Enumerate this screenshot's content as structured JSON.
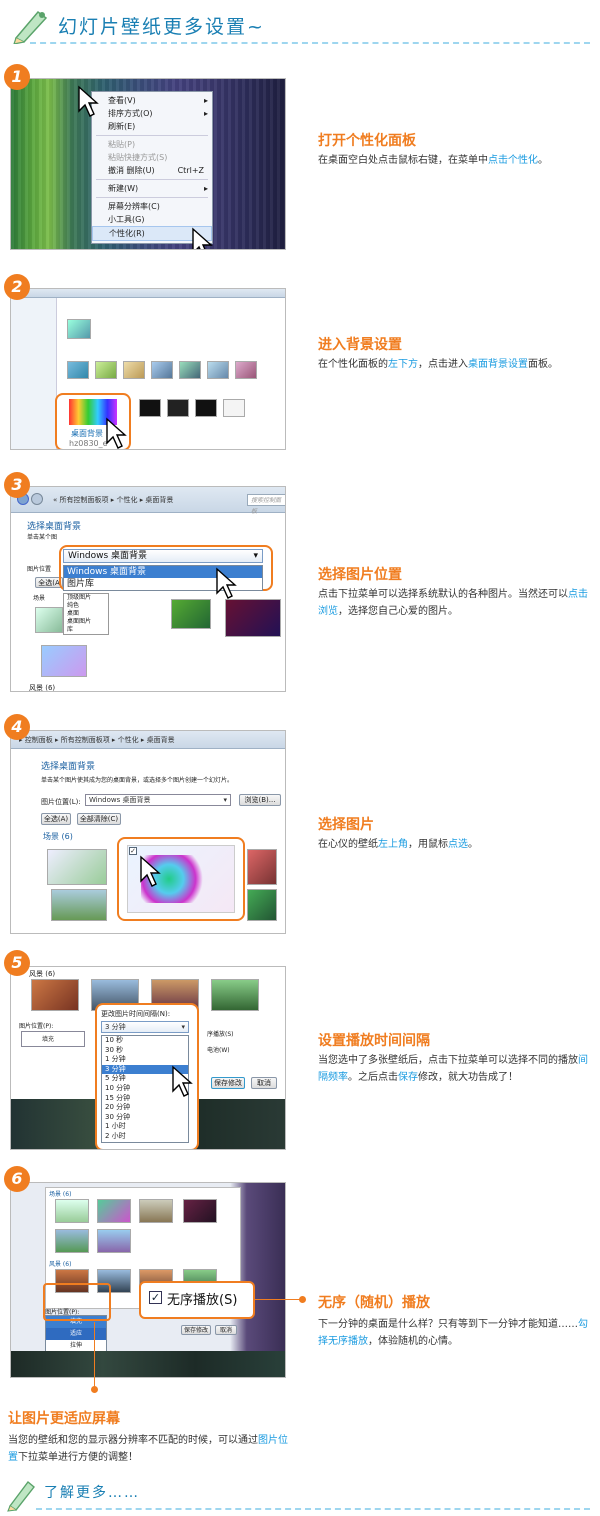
{
  "header": {
    "title": "幻灯片壁纸更多设置~"
  },
  "footer": {
    "title": "了解更多……"
  },
  "steps": [
    {
      "num": "1",
      "title": "打开个性化面板",
      "desc_a": "在桌面空白处点击鼠标右键，在菜单中",
      "desc_hl": "点击个性化",
      "desc_b": "。"
    },
    {
      "num": "2",
      "title": "进入背景设置",
      "desc_a": "在个性化面板的",
      "desc_hl1": "左下方",
      "desc_b": "，点击进入",
      "desc_hl2": "桌面背景设置",
      "desc_c": "面板。"
    },
    {
      "num": "3",
      "title": "选择图片位置",
      "desc_a": "点击下拉菜单可以选择系统默认的各种图片。当然还可以",
      "desc_hl": "点击浏览",
      "desc_b": "，选择您自己心爱的图片。"
    },
    {
      "num": "4",
      "title": "选择图片",
      "desc_a": "在心仪的壁纸",
      "desc_hl1": "左上角",
      "desc_b": "，用鼠标",
      "desc_hl2": "点选",
      "desc_c": "。"
    },
    {
      "num": "5",
      "title": "设置播放时间间隔",
      "desc_a": "当您选中了多张壁纸后，点击下拉菜单可以选择不同的播放",
      "desc_hl1": "间隔频率",
      "desc_b": "。之后点击",
      "desc_hl2": "保存",
      "desc_c": "修改，就大功告成了！"
    },
    {
      "num": "6",
      "title": "无序（随机）播放",
      "desc_a": "下一分钟的桌面是什么样？只有等到下一分钟才能知道……",
      "desc_hl": "勾择无序播放",
      "desc_b": "，体验随机的心情。"
    }
  ],
  "extra": {
    "title": "让图片更适应屏幕",
    "desc_a": "当您的壁纸和您的显示器分辨率不匹配的时候，可以通过",
    "desc_hl": "图片位置",
    "desc_b": "下拉菜单进行方便的调整！"
  },
  "shot1": {
    "menu": [
      "查看(V)",
      "排序方式(O)",
      "刷新(E)",
      "粘贴(P)",
      "粘贴快捷方式(S)",
      "撤消 删除(U)",
      "新建(W)",
      "屏幕分辨率(C)",
      "小工具(G)",
      "个性化(R)"
    ],
    "shortcut": "Ctrl+Z"
  },
  "shot2": {
    "big_label": "桌面背景",
    "file": "hz0830_e"
  },
  "shot3": {
    "bar": "« 所有控制面板项 ▸ 个性化 ▸ 桌面背景",
    "search": "搜索控制面板",
    "heading": "选择桌面背景",
    "sub": "单击某个图",
    "pos": "图片位置",
    "all": "全选(A",
    "dropdown": "Windows 桌面背景",
    "options": [
      "Windows 桌面背景",
      "图片库"
    ],
    "tree": [
      "顶级图片",
      "纯色",
      "桌面",
      "桌面图片",
      "库"
    ],
    "group": "风景 (6)",
    "group_top": "场景"
  },
  "shot4": {
    "bar": "▸ 控制面板 ▸ 所有控制面板项 ▸ 个性化 ▸ 桌面背景",
    "heading": "选择桌面背景",
    "sub": "单击某个图片使其成为您的桌面背景，或选择多个图片创建一个幻灯片。",
    "pos": "图片位置(L):",
    "dropdown": "Windows 桌面背景",
    "browse": "浏览(B)...",
    "all": "全选(A)",
    "clear": "全部清除(C)",
    "group": "场景 (6)"
  },
  "shot5": {
    "group": "风景 (6)",
    "pos": "图片位置(P):",
    "fill": "填充",
    "interval_label": "更改图片时间间隔(N):",
    "selected": "3 分钟",
    "options": [
      "10 秒",
      "30 秒",
      "1 分钟",
      "3 分钟",
      "5 分钟",
      "10 分钟",
      "15 分钟",
      "20 分钟",
      "30 分钟",
      "1 小时",
      "2 小时"
    ],
    "save": "保存修改",
    "cancel": "取消",
    "r1": "序播放(S)",
    "r2": "电池(W)"
  },
  "shot6": {
    "group1": "场景 (6)",
    "group2": "风景 (6)",
    "pos": "图片位置(P):",
    "positions": [
      "填充",
      "适应",
      "拉伸",
      "平铺",
      "居中"
    ],
    "shuffle": "无序播放(S)",
    "save": "保存修改",
    "cancel": "取消"
  }
}
